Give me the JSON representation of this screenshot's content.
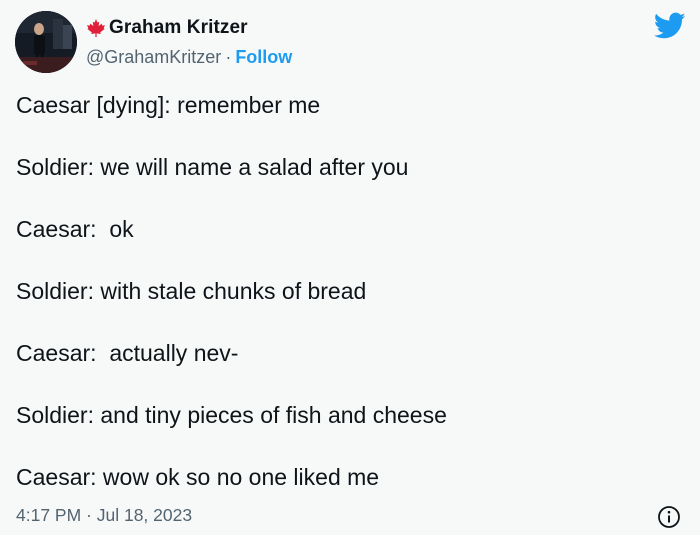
{
  "author": {
    "name": "Graham Kritzer",
    "handle": "@GrahamKritzer",
    "separator": "·",
    "follow_label": "Follow",
    "flag_icon": "maple-leaf-icon",
    "flag_color": "#e0203a"
  },
  "brand": {
    "icon": "twitter-bird-icon",
    "color": "#1d9bf0"
  },
  "tweet": {
    "lines": [
      "Caesar [dying]: remember me",
      "Soldier: we will name a salad after you",
      "Caesar:  ok",
      "Soldier: with stale chunks of bread",
      "Caesar:  actually nev-",
      "Soldier: and tiny pieces of fish and cheese",
      "Caesar: wow ok so no one liked me"
    ],
    "timestamp": "4:17 PM · Jul 18, 2023",
    "info_icon": "info-icon"
  }
}
